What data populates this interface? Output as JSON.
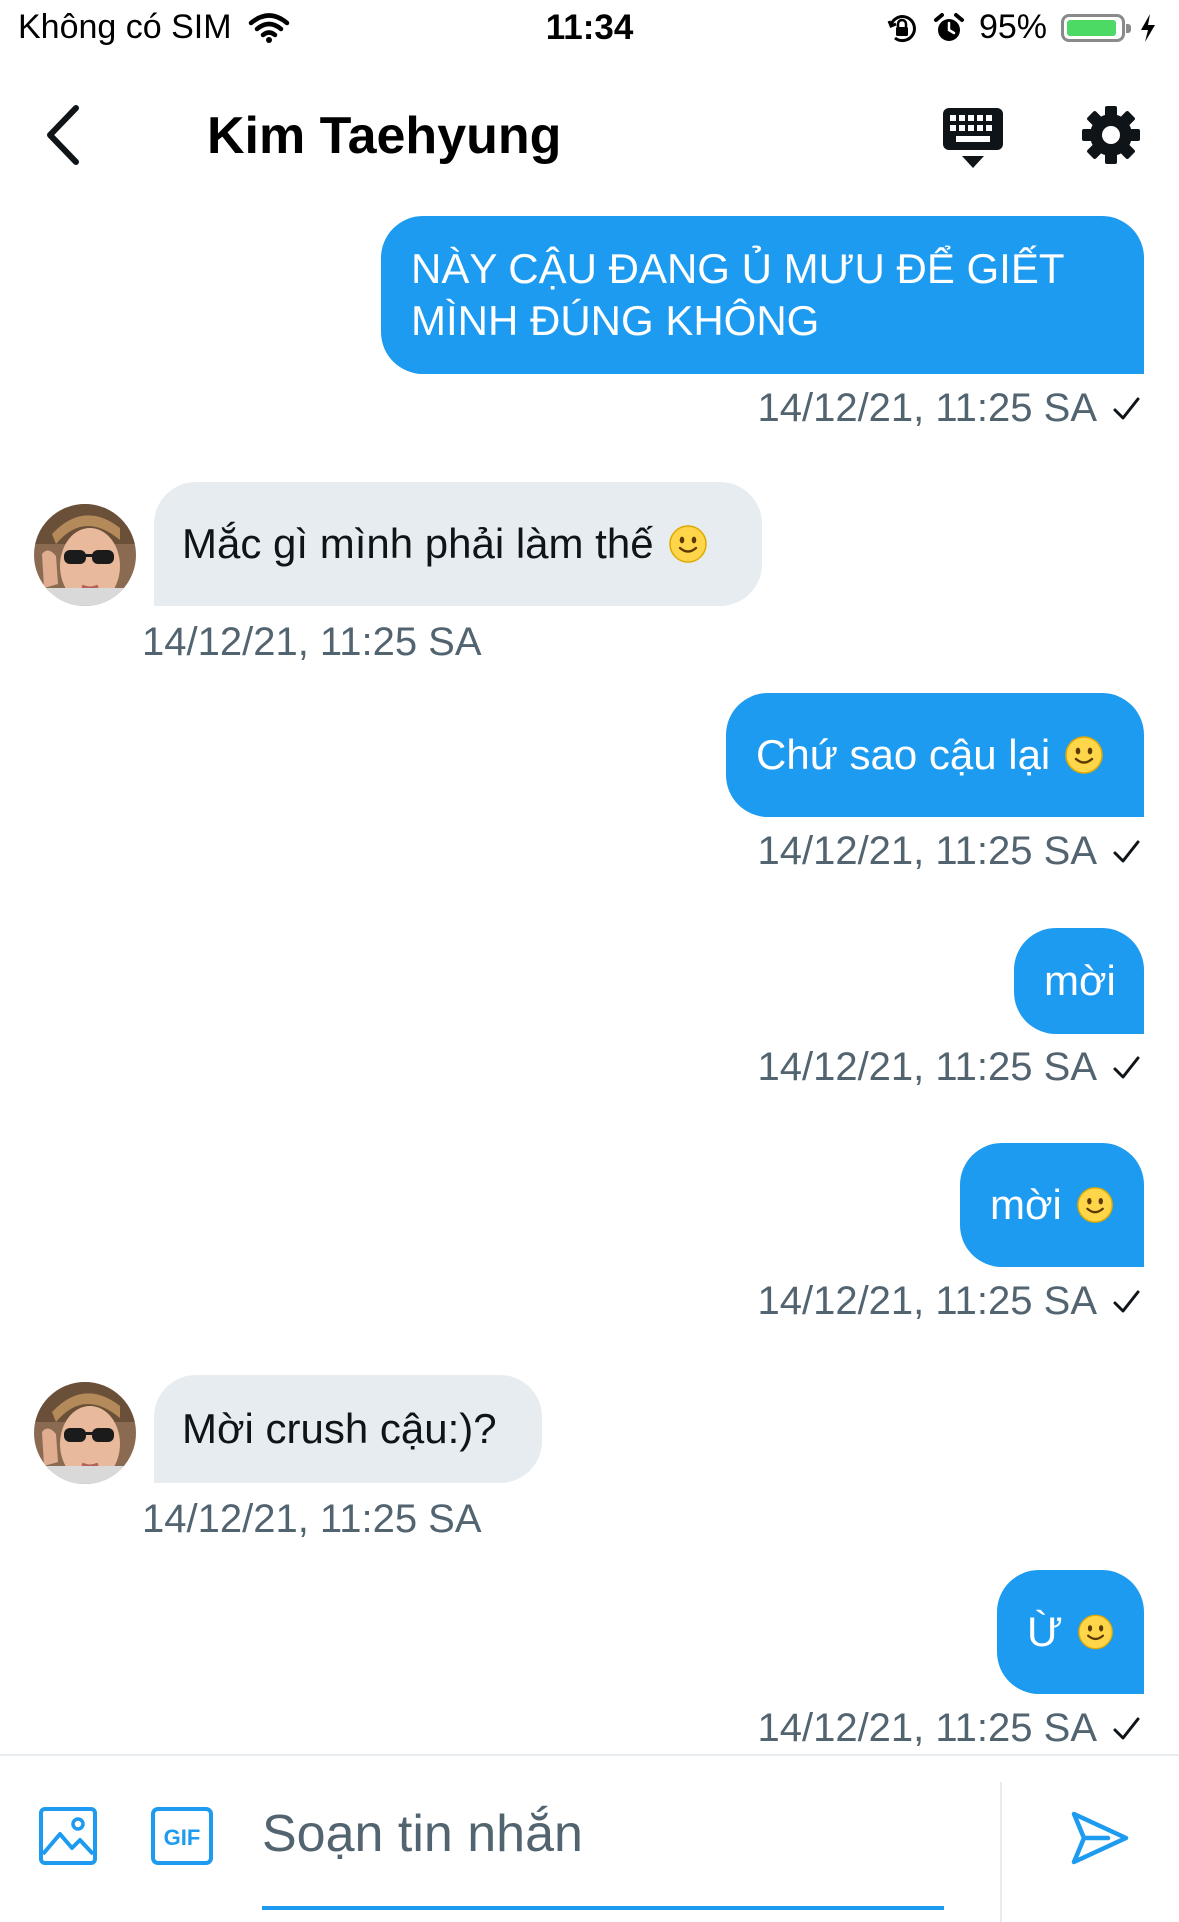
{
  "status_bar": {
    "carrier": "Không có SIM",
    "time": "11:34",
    "battery_percent": "95%",
    "battery_level": 0.95,
    "battery_color": "#4cd964"
  },
  "header": {
    "title": "Kim Taehyung",
    "icons": [
      "back-arrow-icon",
      "keyboard-icon",
      "gear-icon"
    ]
  },
  "theme": {
    "accent": "#1d9bf0",
    "incoming_bubble": "#e6ecf0",
    "timestamp": "#536471"
  },
  "messages": [
    {
      "direction": "outgoing",
      "text": "NÀY CẬU ĐANG Ủ MƯU ĐỂ GIẾT MÌNH ĐÚNG KHÔNG",
      "timestamp": "14/12/21, 11:25 SA",
      "read": true
    },
    {
      "direction": "incoming",
      "text": "Mắc gì mình phải làm thế",
      "emoji": "slightly-smiling-face",
      "timestamp": "14/12/21, 11:25 SA"
    },
    {
      "direction": "outgoing",
      "text": "Chứ sao cậu lại",
      "emoji": "slightly-smiling-face",
      "timestamp": "14/12/21, 11:25 SA",
      "read": true
    },
    {
      "direction": "outgoing",
      "text": "mời",
      "timestamp": "14/12/21, 11:25 SA",
      "read": true
    },
    {
      "direction": "outgoing",
      "text": "mời",
      "emoji": "slightly-smiling-face",
      "timestamp": "14/12/21, 11:25 SA",
      "read": true
    },
    {
      "direction": "incoming",
      "text": "Mời crush cậu:)?",
      "timestamp": "14/12/21, 11:25 SA"
    },
    {
      "direction": "outgoing",
      "text": "Ừ",
      "emoji": "slightly-smiling-face",
      "timestamp": "14/12/21, 11:25 SA",
      "read": true
    }
  ],
  "composer": {
    "placeholder": "Soạn tin nhắn",
    "gif_label": "GIF",
    "icons": [
      "image-icon",
      "gif-icon",
      "send-icon"
    ]
  }
}
